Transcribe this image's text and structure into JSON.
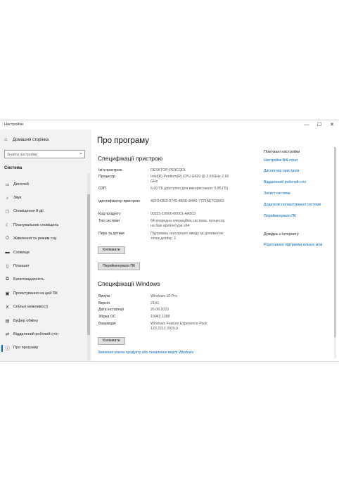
{
  "window": {
    "title": "Настройки",
    "controls": {
      "minimize": "—",
      "maximize": "☐",
      "close": "✕"
    }
  },
  "sidebar": {
    "home_label": "Домашня сторінка",
    "search_placeholder": "Знайти настройки",
    "section_label": "Система",
    "items": [
      {
        "label": "Дисплей",
        "icon": "display-icon",
        "glyph": "▭"
      },
      {
        "label": "Звук",
        "icon": "sound-icon",
        "glyph": "♪"
      },
      {
        "label": "Сповіщення й дії",
        "icon": "notifications-icon",
        "glyph": "▢"
      },
      {
        "label": "Планувальник сповіщень",
        "icon": "moon-icon",
        "glyph": "☾"
      },
      {
        "label": "Живлення та режим сну",
        "icon": "power-icon",
        "glyph": "⏻"
      },
      {
        "label": "Сховище",
        "icon": "storage-icon",
        "glyph": "▬"
      },
      {
        "label": "Планшет",
        "icon": "tablet-icon",
        "glyph": "▯"
      },
      {
        "label": "Багатозадачність",
        "icon": "multitasking-icon",
        "glyph": "⧉"
      },
      {
        "label": "Проектування на цей ПК",
        "icon": "project-icon",
        "glyph": "▣"
      },
      {
        "label": "Спільні можливості",
        "icon": "shared-icon",
        "glyph": "✕"
      },
      {
        "label": "Буфер обміну",
        "icon": "clipboard-icon",
        "glyph": "▤"
      },
      {
        "label": "Віддалений робочий стіл",
        "icon": "remote-desktop-icon",
        "glyph": "⇄"
      },
      {
        "label": "Про програму",
        "icon": "info-icon",
        "glyph": "ⓘ",
        "selected": true
      }
    ]
  },
  "main": {
    "title": "Про програму",
    "device_specs": {
      "heading": "Специфікації пристрою",
      "rows": [
        {
          "key": "Ім'я пристрою",
          "value": "DESKTOP-PE9CQDL"
        },
        {
          "key": "Процесор",
          "value": "Intel(R) Pentium(R) CPU G620 @ 2.60GHz 2.60 GHz"
        },
        {
          "key": "ОЗП",
          "value": "6,00 ГБ (доступно для використання: 5,85 ГБ)"
        },
        {
          "key": "Ідентифікатор пристрою",
          "value": "4EF943E0-0745-4B0D-84A6-7721AE7C0063"
        },
        {
          "key": "Код продукту",
          "value": "00331-10000-00001-AA503"
        },
        {
          "key": "Тип системи",
          "value": "64-розрядна операційна система, процесор на базі архітектури x64"
        },
        {
          "key": "Перо та дотики",
          "value": "Підтримка сенсорного вводу за допомогою точок дотику: 2"
        }
      ],
      "copy_button": "Копіювати",
      "rename_button": "Перейменувати ПК"
    },
    "windows_specs": {
      "heading": "Специфікації Windows",
      "rows": [
        {
          "key": "Випуск",
          "value": "Windows 10 Pro"
        },
        {
          "key": "Версія",
          "value": "21H1"
        },
        {
          "key": "Дата інсталяції",
          "value": "26.08.2023"
        },
        {
          "key": "Збірка ОС",
          "value": "19043.1288"
        },
        {
          "key": "Взаємодія",
          "value": "Windows Feature Experience Pack 120.2212.3920.0"
        }
      ],
      "copy_button": "Копіювати",
      "change_key_link": "Змінення ключа продукту або оновлення версії Windows"
    }
  },
  "related": {
    "heading": "Пов'язані настройки",
    "links": [
      "Настройки BitLocker",
      "Диспетчер пристроїв",
      "Віддалений робочий стіл",
      "Захист системи",
      "Додаткові налаштування системи",
      "Перейменувати ПК"
    ],
    "help_heading": "Довідка з Інтернету",
    "help_link": "Розв'язання підтримки кількох мов"
  },
  "colors": {
    "accent": "#0067c0",
    "sidebar_bg": "#f2f2f2"
  }
}
